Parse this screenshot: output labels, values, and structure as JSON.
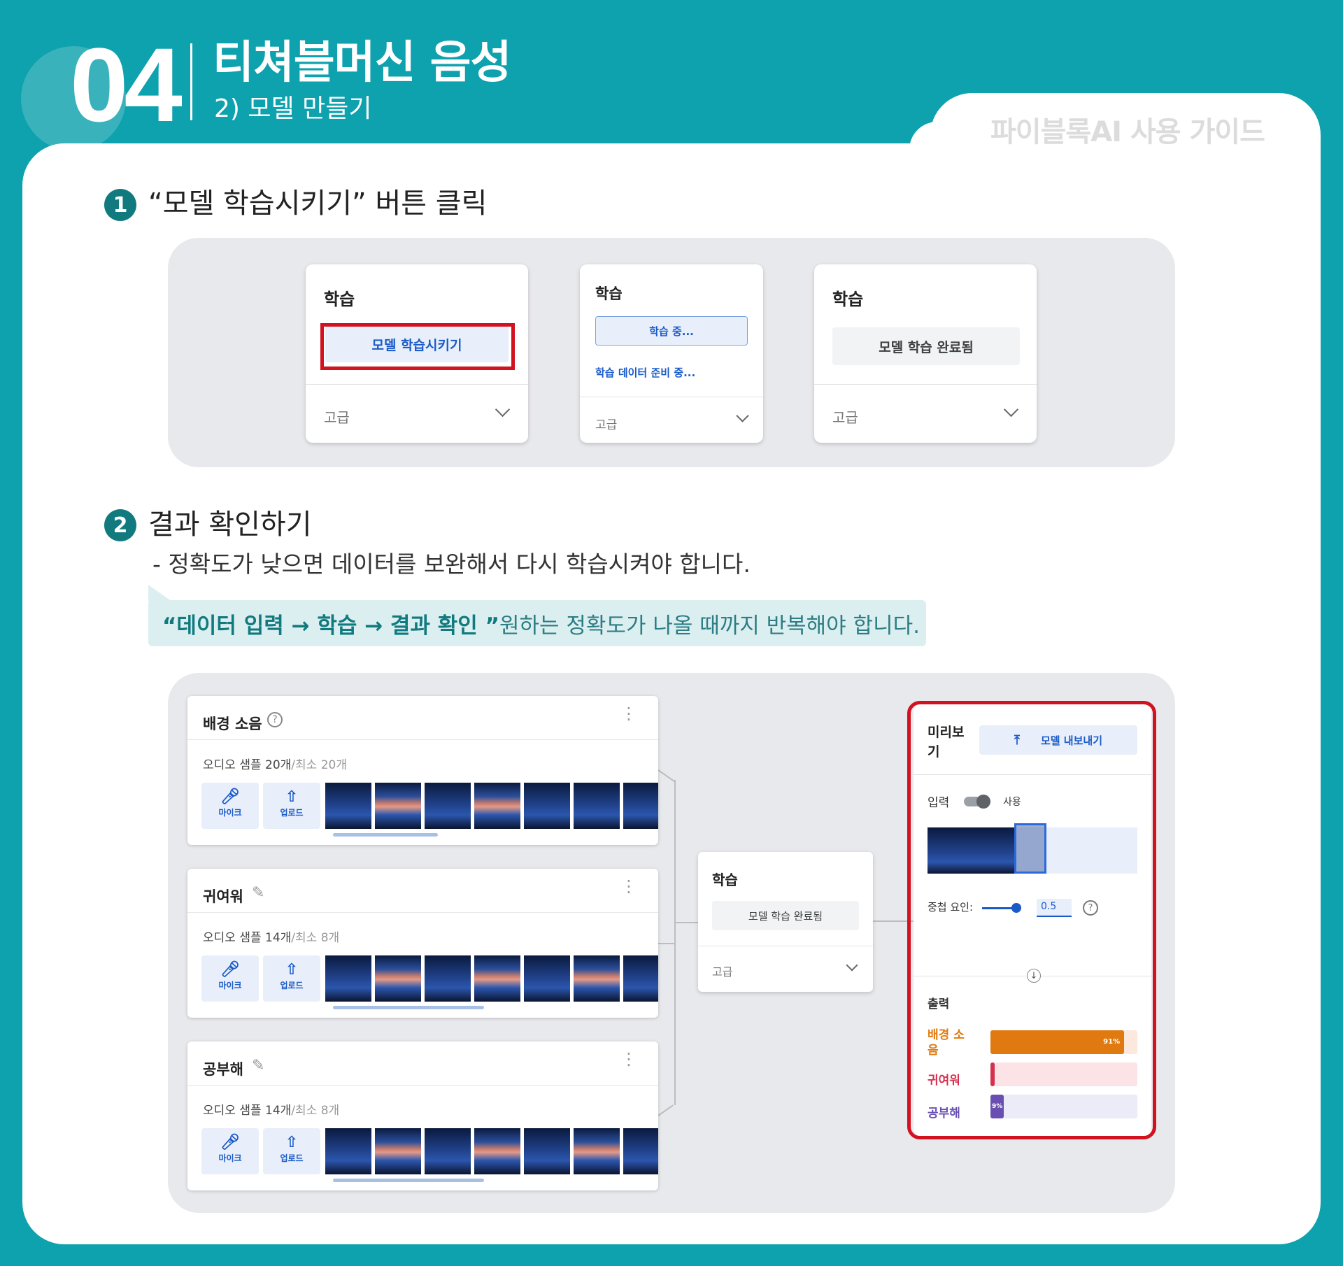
{
  "header": {
    "number": "04",
    "title": "티쳐블머신 음성",
    "subtitle": "2) 모델 만들기",
    "guide_label": "파이블록AI 사용 가이드"
  },
  "step1": {
    "badge": "1",
    "text": "“모델 학습시키기” 버튼 클릭",
    "cards": [
      {
        "title": "학습",
        "button": "모델 학습시키기",
        "advanced": "고급"
      },
      {
        "title": "학습",
        "button": "학습 중...",
        "status": "학습 데이터 준비 중...",
        "advanced": "고급"
      },
      {
        "title": "학습",
        "button": "모델 학습 완료됨",
        "advanced": "고급"
      }
    ]
  },
  "step2": {
    "badge": "2",
    "text": "결과 확인하기",
    "note": "- 정확도가 낮으면 데이터를 보완해서 다시 학습시켜야 합니다.",
    "callout_bold": "“데이터 입력 → 학습 → 결과 확인 ”",
    "callout_rest": " 원하는 정확도가 나올 때까지 반복해야 합니다."
  },
  "classes": [
    {
      "name": "배경 소음",
      "count": "오디오 샘플 20개",
      "min": "/최소 20개",
      "mic": "마이크",
      "upload": "업로드"
    },
    {
      "name": "귀여워",
      "count": "오디오 샘플 14개",
      "min": "/최소 8개",
      "mic": "마이크",
      "upload": "업로드"
    },
    {
      "name": "공부해",
      "count": "오디오 샘플 14개",
      "min": "/최소 8개",
      "mic": "마이크",
      "upload": "업로드"
    }
  ],
  "train_card": {
    "title": "학습",
    "button": "모델 학습 완료됨",
    "advanced": "고급"
  },
  "preview": {
    "title": "미리보기",
    "export_button": "모델 내보내기",
    "input_label": "입력",
    "toggle_label": "사용",
    "overlap_label": "중첩 요인:",
    "overlap_value": "0.5",
    "output_label": "출력",
    "outputs": [
      {
        "label": "배경 소음",
        "percent_label": "91%",
        "value": 0.91,
        "color": "#e07a10",
        "bg": "#fce8dd"
      },
      {
        "label": "귀여워",
        "percent_label": "",
        "value": 0.0,
        "color": "#d6304f",
        "bg": "#fbe3e6"
      },
      {
        "label": "공부해",
        "percent_label": "9%",
        "value": 0.09,
        "color": "#6a4fb3",
        "bg": "#ecebf8"
      }
    ]
  },
  "colors": {
    "teal": "#0ea1ae",
    "badge": "#117a7f",
    "highlight_red": "#d2121f",
    "button_blue": "#1a5ac8"
  }
}
